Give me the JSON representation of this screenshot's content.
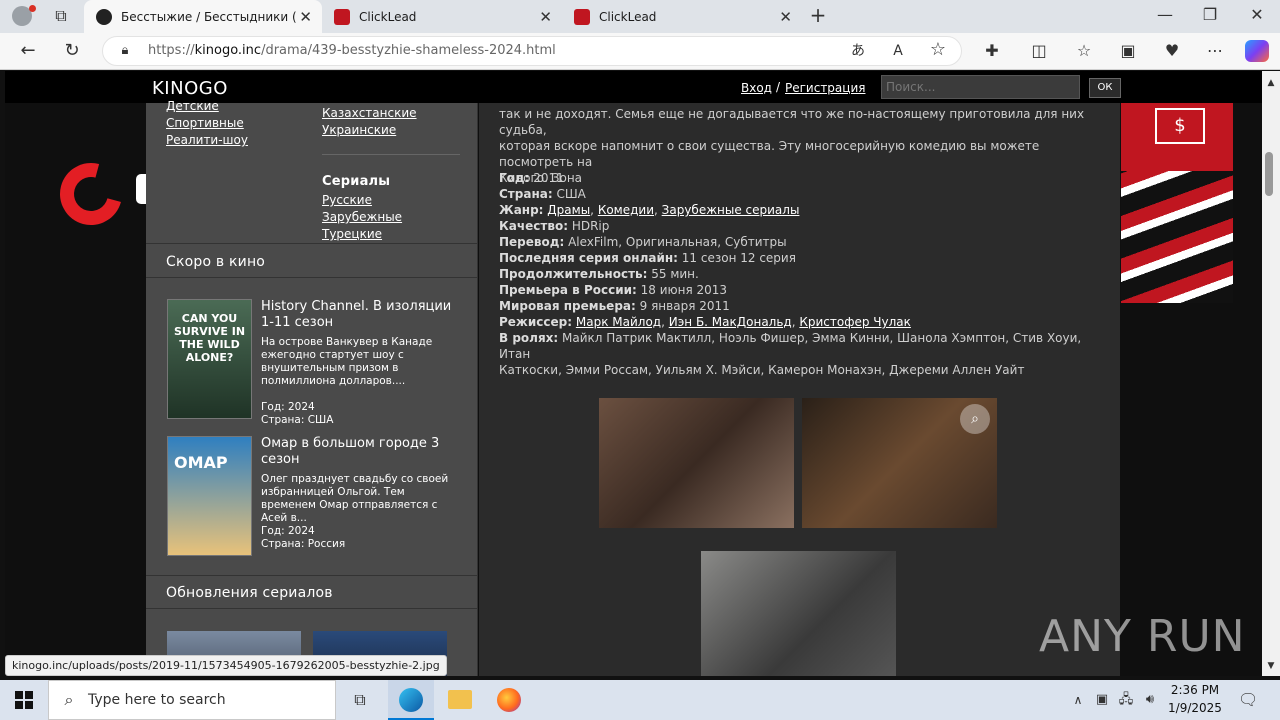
{
  "tabs": [
    {
      "title": "Бесстыжие / Бесстыдники (2011"
    },
    {
      "title": "ClickLead"
    },
    {
      "title": "ClickLead"
    }
  ],
  "url": {
    "scheme": "https://",
    "host": "kinogo.inc",
    "path": "/drama/439-besstyzhie-shameless-2024.html"
  },
  "site": {
    "logo": "KINOGO",
    "login": "Вход",
    "sep": "/",
    "register": "Регистрация",
    "search_placeholder": "Поиск...",
    "search_btn": "ОК"
  },
  "categories": {
    "left": [
      "Детские",
      "Спортивные",
      "Реалити-шоу"
    ],
    "right": [
      "Казахстанские",
      "Украинские"
    ],
    "series_title": "Сериалы",
    "series": [
      "Русские",
      "Зарубежные",
      "Турецкие"
    ]
  },
  "soon": {
    "title": "Скоро в кино",
    "items": [
      {
        "title": "History Channel. В изоляции 1-11 сезон",
        "desc": "На острове Ванкувер в Канаде ежегодно стартует шоу с внушительным призом в полмиллиона долларов....",
        "year": "Год: 2024",
        "country": "Страна: США",
        "poster": "CAN YOU SURVIVE IN THE WILD ALONE?"
      },
      {
        "title": "Омар в большом городе 3 сезон",
        "desc": "Олег празднует свадьбу со своей избранницей Ольгой. Тем временем Омар отправляется с Асей в...",
        "year": "Год: 2024",
        "country": "Страна: Россия",
        "poster": "ОМАР"
      }
    ]
  },
  "updates": {
    "title": "Обновления сериалов"
  },
  "description": {
    "line1": "так и не доходят. Семья еще не догадывается что же по-настоящему приготовила для них судьба,",
    "line2": "которая вскоре напомнит о свои существа. Эту многосерийную комедию вы можете посмотреть на",
    "line3": "Киного. Зона"
  },
  "info": {
    "year_l": "Год:",
    "year": "2011",
    "country_l": "Страна:",
    "country": "США",
    "genre_l": "Жанр:",
    "genres": [
      "Драмы",
      "Комедии",
      "Зарубежные сериалы"
    ],
    "quality_l": "Качество:",
    "quality": "HDRip",
    "translation_l": "Перевод:",
    "translation": "AlexFilm, Оригинальная, Субтитры",
    "last_l": "Последняя серия онлайн:",
    "last": "11 сезон 12 серия",
    "duration_l": "Продолжительность:",
    "duration": "55 мин.",
    "prem_ru_l": "Премьера в России:",
    "prem_ru": "18 июня 2013",
    "prem_w_l": "Мировая премьера:",
    "prem_w": "9 января 2011",
    "director_l": "Режиссер:",
    "directors": [
      "Марк Майлод",
      "Иэн Б. МакДональд",
      "Кристофер Чулак"
    ],
    "cast_l": "В ролях:",
    "cast1": "Майкл Патрик Мактилл, Ноэль Фишер, Эмма Кинни, Шанола Хэмптон, Стив Хоуи, Итан",
    "cast2": "Каткоски, Эмми Россам, Уильям Х. Мэйси, Камерон Монахэн, Джереми Аллен Уайт"
  },
  "status_url": "kinogo.inc/uploads/posts/2019-11/1573454905-1679262005-besstyzhie-2.jpg",
  "watermark": "ANY RUN",
  "taskbar": {
    "search": "Type here to search",
    "time": "2:36 PM",
    "date": "1/9/2025"
  },
  "colors": {
    "accent": "#0078d4",
    "ad_red": "#c01620"
  }
}
